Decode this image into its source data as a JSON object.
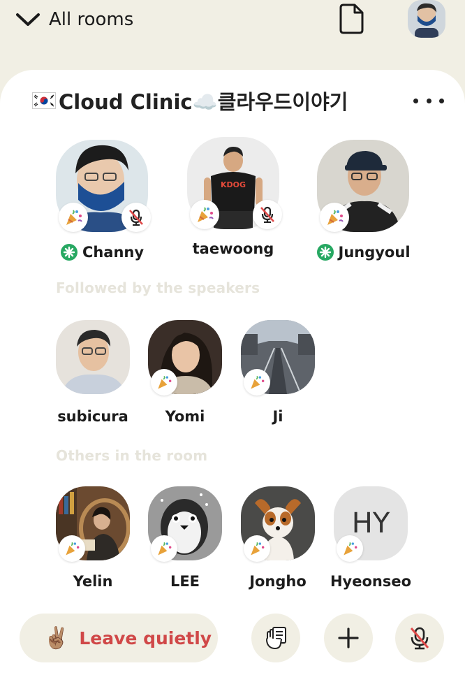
{
  "header": {
    "back_label": "All rooms",
    "back_icon": "chevron-down-icon",
    "doc_icon": "document-icon",
    "profile_icon": "profile-avatar"
  },
  "room": {
    "title": "Cloud Clinic☁️클라우드이야기",
    "flag": "south-korea-flag",
    "more_icon": "more-options-icon"
  },
  "speakers": [
    {
      "name": "Channy",
      "moderator": true,
      "muted": true
    },
    {
      "name": "taewoong",
      "moderator": false,
      "muted": true
    },
    {
      "name": "Jungyoul",
      "moderator": true,
      "muted": false
    }
  ],
  "followed_label": "Followed by the speakers",
  "followed": [
    {
      "name": "subicura"
    },
    {
      "name": "Yomi"
    },
    {
      "name": "Ji"
    }
  ],
  "others_label": "Others in the room",
  "others": [
    {
      "name": "Yelin",
      "initials": ""
    },
    {
      "name": "LEE",
      "initials": ""
    },
    {
      "name": "Jongho",
      "initials": ""
    },
    {
      "name": "Hyeonseo",
      "initials": "HY"
    }
  ],
  "footer": {
    "leave_emoji": "✌🏽",
    "leave_label": "Leave quietly",
    "raise_hand_icon": "raise-hand-icon",
    "add_icon": "plus-icon",
    "mic_icon": "mic-muted-icon"
  },
  "colors": {
    "background": "#f1efe4",
    "card": "#ffffff",
    "leave_text": "#d04848",
    "moderator_green": "#27a862",
    "muted_red": "#e04a4a",
    "section_label": "#e6e4db"
  }
}
